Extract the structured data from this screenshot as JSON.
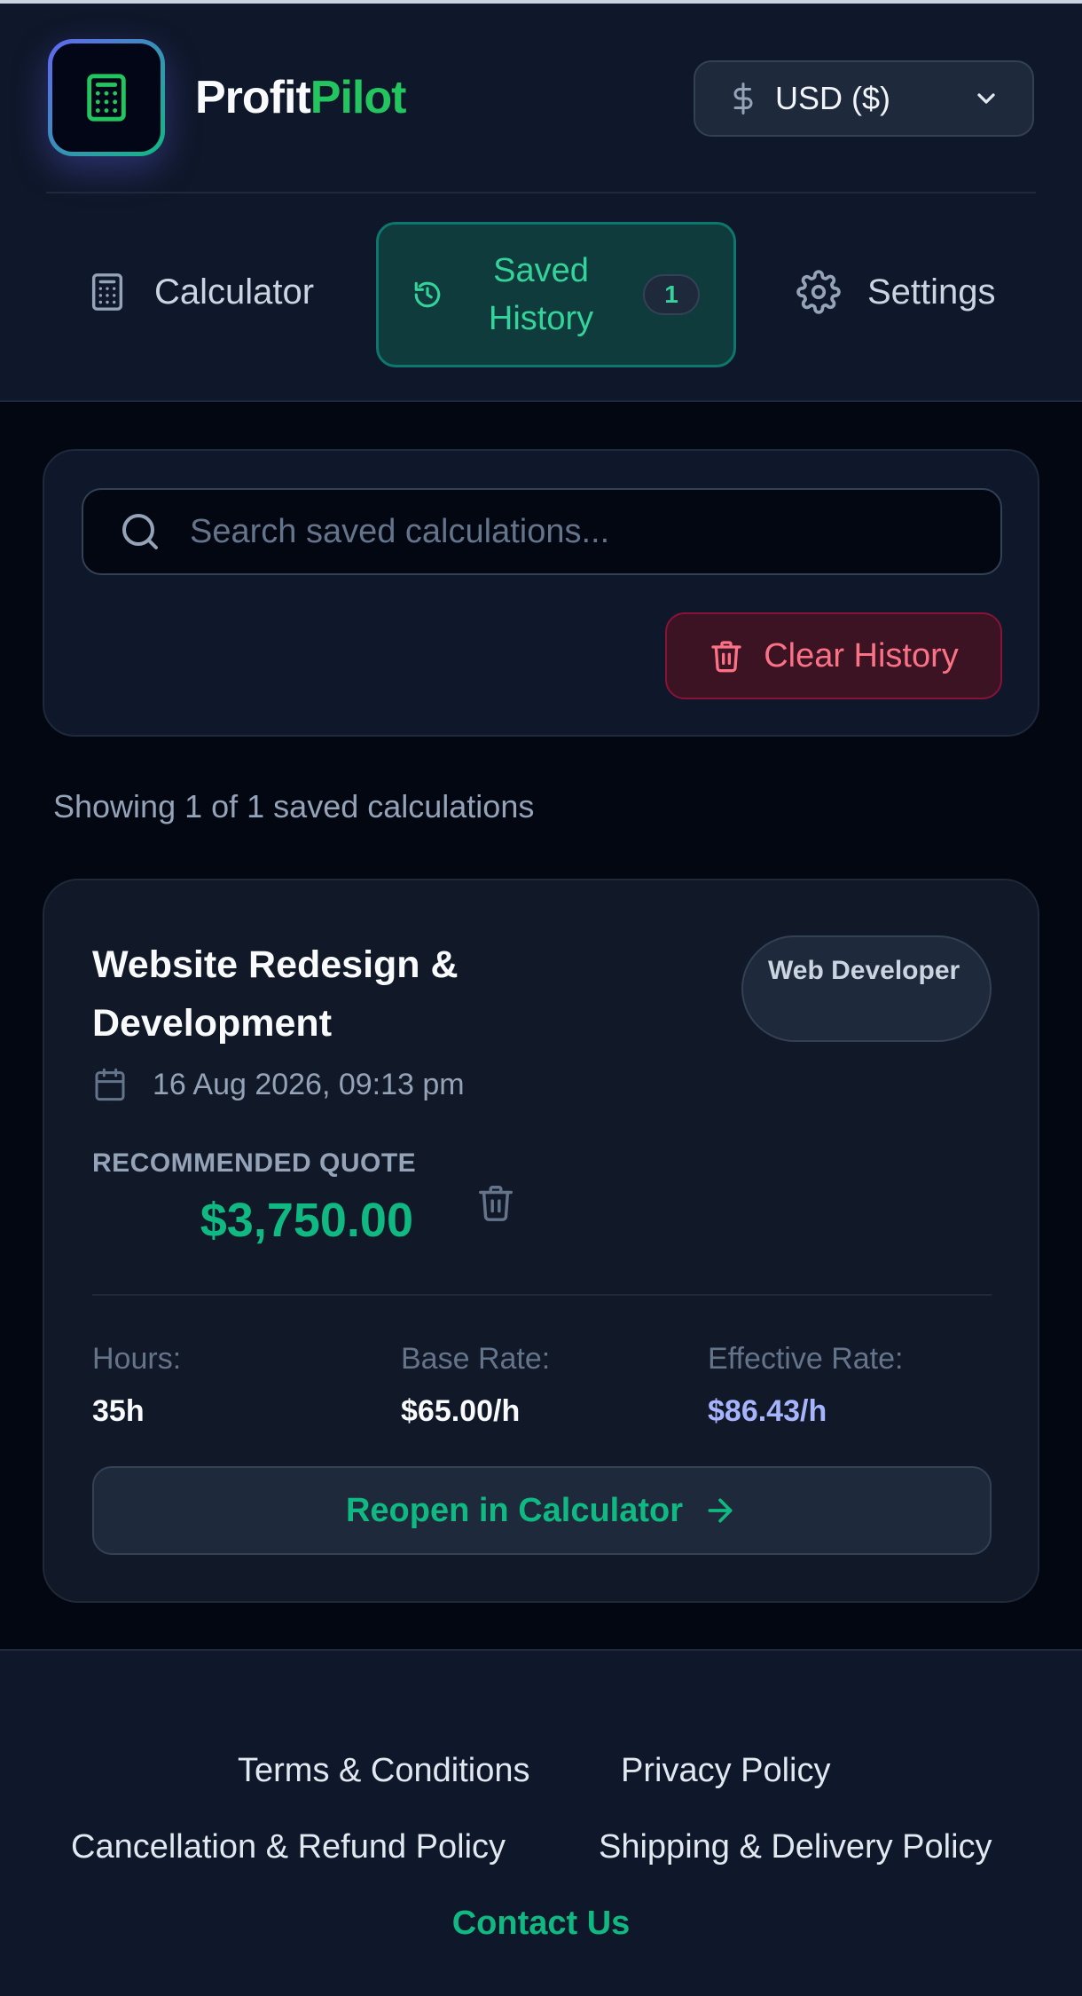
{
  "app": {
    "brand_part1": "Profit",
    "brand_part2": "Pilot",
    "currency": "USD ($)"
  },
  "nav": {
    "calculator": "Calculator",
    "history": "Saved History",
    "history_count": "1",
    "settings": "Settings"
  },
  "search": {
    "placeholder": "Search saved calculations...",
    "value": ""
  },
  "actions": {
    "clear_history": "Clear History"
  },
  "summary": "Showing 1 of 1 saved calculations",
  "saved": {
    "title": "Website Redesign & Development",
    "role": "Web Developer",
    "date": "16 Aug 2026, 09:13 pm",
    "quote_label": "RECOMMENDED QUOTE",
    "quote_value": "$3,750.00",
    "hours_label": "Hours:",
    "hours_value": "35h",
    "base_label": "Base Rate:",
    "base_value": "$65.00/h",
    "eff_label": "Effective Rate:",
    "eff_value": "$86.43/h",
    "reopen_label": "Reopen in Calculator"
  },
  "footer": {
    "terms": "Terms & Conditions",
    "privacy": "Privacy Policy",
    "refund": "Cancellation & Refund Policy",
    "shipping": "Shipping & Delivery Policy",
    "contact": "Contact Us"
  },
  "colors": {
    "accent_green": "#10b981",
    "danger": "#fb7185",
    "indigo": "#a5b4fc",
    "background": "#030712",
    "surface": "#0f172a"
  }
}
